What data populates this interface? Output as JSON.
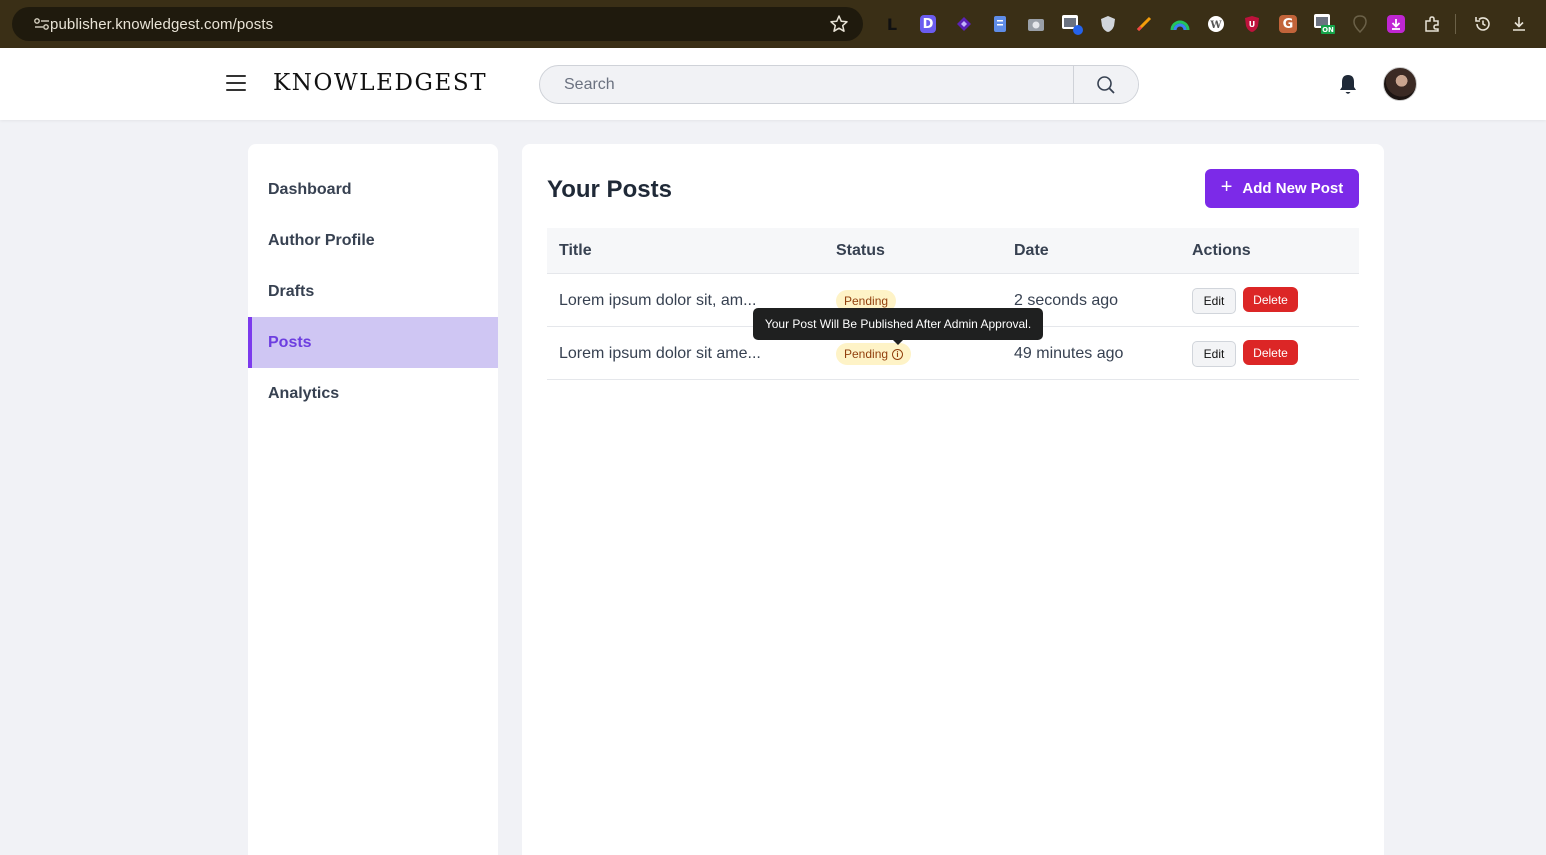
{
  "browser": {
    "url": "publisher.knowledgest.com/posts",
    "extensions": [
      "L",
      "D",
      "diamond-ext",
      "doc-ext",
      "camera-ext",
      "window-ext",
      "shield-ext",
      "pen-ext",
      "rainbow-ext",
      "wp-ext",
      "ublock-ext",
      "G",
      "on-ext",
      "pin-ext",
      "download-ext",
      "puzzle-ext"
    ]
  },
  "header": {
    "logo": "KNOWLEDGEST",
    "search_placeholder": "Search"
  },
  "sidebar": {
    "items": [
      {
        "label": "Dashboard",
        "active": false
      },
      {
        "label": "Author Profile",
        "active": false
      },
      {
        "label": "Drafts",
        "active": false
      },
      {
        "label": "Posts",
        "active": true
      },
      {
        "label": "Analytics",
        "active": false
      }
    ]
  },
  "main": {
    "title": "Your Posts",
    "add_button": "Add New Post",
    "columns": [
      "Title",
      "Status",
      "Date",
      "Actions"
    ],
    "rows": [
      {
        "title": "Lorem ipsum dolor sit, am...",
        "status": "Pending",
        "date": "2 seconds ago",
        "edit": "Edit",
        "delete": "Delete"
      },
      {
        "title": "Lorem ipsum dolor sit ame...",
        "status": "Pending",
        "date": "49 minutes ago",
        "edit": "Edit",
        "delete": "Delete"
      }
    ],
    "tooltip": "Your Post Will Be Published After Admin Approval."
  },
  "colors": {
    "accent": "#7c2ae8",
    "active_nav_bg": "#cfc6f3",
    "delete": "#dc2626",
    "pending_bg": "#fef3c7"
  }
}
